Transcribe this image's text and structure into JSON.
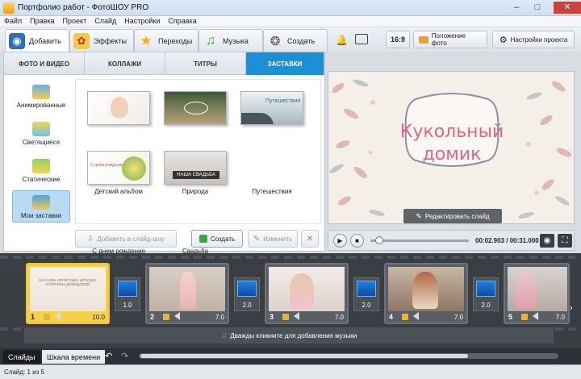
{
  "window": {
    "title": "Портфолио работ - ФотоШОУ PRO"
  },
  "menu": [
    "Файл",
    "Правка",
    "Проект",
    "Слайд",
    "Настройки",
    "Справка"
  ],
  "main_tabs": [
    {
      "label": "Добавить",
      "icon": "camera-icon"
    },
    {
      "label": "Эффекты",
      "icon": "palette-icon"
    },
    {
      "label": "Переходы",
      "icon": "star-icon"
    },
    {
      "label": "Музыка",
      "icon": "music-note-icon"
    },
    {
      "label": "Создать",
      "icon": "film-reel-icon"
    }
  ],
  "toolbar": {
    "aspect": "16:9",
    "photo_position": "Положение фото",
    "project_settings": "Настройки проекта"
  },
  "sub_tabs": [
    "ФОТО И ВИДЕО",
    "КОЛЛАЖИ",
    "ТИТРЫ",
    "ЗАСТАВКИ"
  ],
  "categories": [
    "Анимированные",
    "Светящиеся",
    "Статические",
    "Мои заставки"
  ],
  "intros": [
    "Детский альбом",
    "Природа",
    "Путешествия",
    "С днем рождения",
    "Свадьба"
  ],
  "thumb_texts": {
    "travel": "Путешествия",
    "birthday": "С днем рождения",
    "wedding": "НАША СВАДЬБА"
  },
  "panel_buttons": {
    "add_to_show": "Добавить в слайд-шоу",
    "create": "Создать",
    "edit": "Изменить"
  },
  "preview": {
    "line1": "Кукольный",
    "line2": "домик",
    "edit_slide": "Редактировать слайд"
  },
  "player": {
    "time": "00:02.903 / 00:31.000",
    "progress": 0.09
  },
  "slides": [
    {
      "num": "1",
      "dur": "10.0",
      "text": "МАГАЗИН АВТОРСКИХ ИГРУШЕК КАТЕРИНЫ ДЕМИДОВОЙ"
    },
    {
      "num": "2",
      "dur": "7.0"
    },
    {
      "num": "3",
      "dur": "7.0"
    },
    {
      "num": "4",
      "dur": "7.0"
    },
    {
      "num": "5",
      "dur": "7.0"
    }
  ],
  "transitions": [
    "1.0",
    "2.0",
    "2.0",
    "2.0"
  ],
  "music_hint": "Дважды кликните для добавления музыки",
  "bottom_tabs": [
    "Слайды",
    "Шкала времени"
  ],
  "status": "Слайд: 1 из 5",
  "colors": {
    "accent": "#1d8fd6",
    "selected_slide": "#f6d04d",
    "title_pink": "#e8618c"
  }
}
